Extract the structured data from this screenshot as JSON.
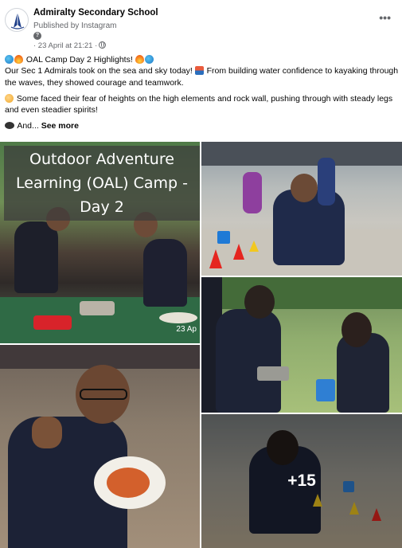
{
  "header": {
    "page_name": "Admiralty Secondary School",
    "publisher": "Published by Instagram",
    "pin_glyph": "?",
    "timestamp": "· 23 April at 21:21 ·",
    "more_glyph": "•••"
  },
  "post": {
    "title": "OAL Camp Day 2 Highlights!",
    "para1": "Our Sec 1 Admirals took on the sea and sky today!",
    "para1_b": "From building water confidence to kayaking through the waves, they showed courage and teamwork.",
    "para2": "Some faced their fear of heights on the high elements and rock wall, pushing through with steady legs and even steadier spirits!",
    "para3": "And...",
    "see_more": "See more"
  },
  "photos": {
    "overlay_title": "Outdoor Adventure Learning (OAL) Camp - Day 2",
    "date_stamp": "23 Ap",
    "more_count": "+15"
  },
  "colors": {
    "text": "#050505",
    "secondary_text": "#65676b"
  },
  "icons": [
    "school-logo-icon",
    "pin-icon",
    "globe-icon",
    "more-options-icon",
    "wave-emoji-icon",
    "fire-emoji-icon",
    "boat-emoji-icon",
    "flexed-biceps-emoji-icon",
    "speech-bubble-emoji-icon"
  ]
}
